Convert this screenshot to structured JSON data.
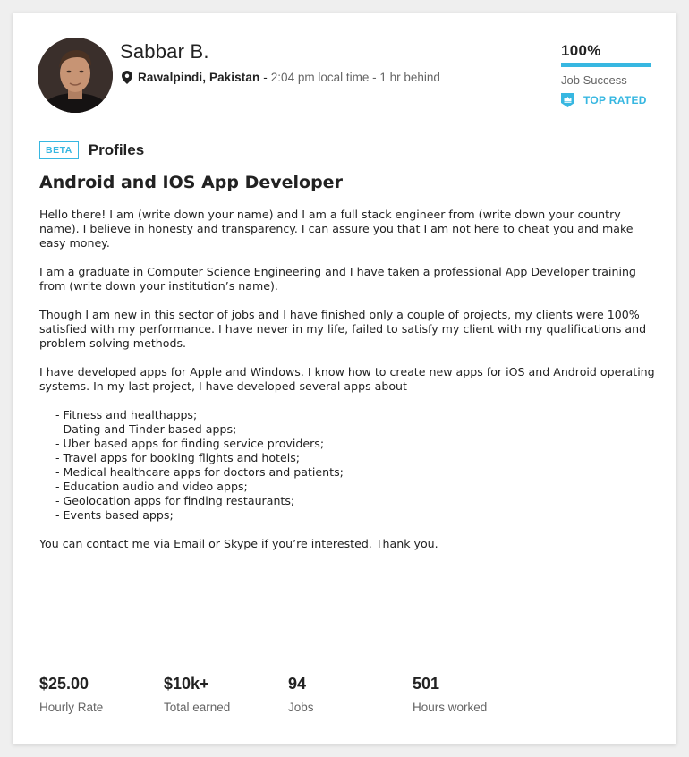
{
  "profile": {
    "name": "Sabbar B.",
    "location": "Rawalpindi, Pakistan",
    "separator": "-",
    "local_time_text": "2:04 pm local time - 1 hr behind",
    "avatar_icon": "user-photo"
  },
  "job_success": {
    "percent_label": "100%",
    "percent_value": 100,
    "label": "Job Success",
    "bar_color": "#37b7e1"
  },
  "badge": {
    "icon": "crown-shield-icon",
    "label": "TOP RATED",
    "color": "#37b7e1"
  },
  "section": {
    "beta_label": "BETA",
    "profiles_label": "Profiles"
  },
  "job_title": "Android and IOS App Developer",
  "description": {
    "paragraphs": [
      "Hello there! I am (write down your name) and I am a full stack engineer from (write down your country name). I believe in honesty and transparency. I can assure you that I am not here to cheat you and make easy money.",
      "I am a graduate in Computer Science Engineering and I have taken a professional App Developer training from (write down your institution’s name).",
      "Though I am new in this sector of jobs and I have finished only a couple of projects, my clients were 100% satisfied with my performance. I have never in my life, failed to satisfy my client with my qualifications and problem solving methods.",
      "I have developed apps for Apple and Windows. I know how to create new apps for iOS and Android operating systems. In my last project, I have developed several apps about -"
    ],
    "list": [
      "- Fitness and healthapps;",
      "- Dating and Tinder based apps;",
      "- Uber based apps for finding service providers;",
      "- Travel apps for booking flights and hotels;",
      "- Medical healthcare apps for doctors and patients;",
      "- Education audio and video apps;",
      "- Geolocation apps for finding restaurants;",
      "- Events based apps;"
    ],
    "closing": "You can contact me via Email or Skype if you’re interested. Thank you."
  },
  "stats": [
    {
      "value": "$25.00",
      "label": "Hourly Rate"
    },
    {
      "value": "$10k+",
      "label": "Total earned"
    },
    {
      "value": "94",
      "label": "Jobs"
    },
    {
      "value": "501",
      "label": "Hours worked"
    }
  ]
}
